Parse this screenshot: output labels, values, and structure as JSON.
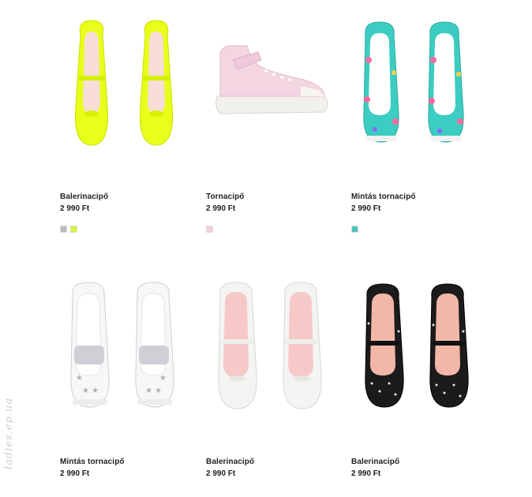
{
  "products": [
    {
      "title": "Balerinacipő",
      "price": "2 990 Ft",
      "image_icon": "neon-ballet-flats-icon",
      "swatches": [
        "#b9bcc0",
        "#d8f53a"
      ]
    },
    {
      "title": "Tornacipő",
      "price": "2 990 Ft",
      "image_icon": "pink-high-top-sneaker-icon",
      "swatches": [
        "#f1cfdc"
      ]
    },
    {
      "title": "Mintás tornacipő",
      "price": "2 990 Ft",
      "image_icon": "floral-slip-on-icon",
      "swatches": [
        "#4cc3b8"
      ]
    },
    {
      "title": "Mintás tornacipő",
      "price": "2 990 Ft",
      "image_icon": "star-print-slip-on-icon",
      "swatches": []
    },
    {
      "title": "Balerinacipő",
      "price": "2 990 Ft",
      "image_icon": "white-ballet-flats-icon",
      "swatches": []
    },
    {
      "title": "Balerinacipő",
      "price": "2 990 Ft",
      "image_icon": "black-polka-ballet-flats-icon",
      "swatches": []
    }
  ],
  "watermark": "ladies.ep.ua",
  "colors": {
    "neon": "#e8ff1a",
    "pink": "#f4d6e3",
    "teal": "#3ccdc2",
    "white_shoe": "#f4f4f2",
    "black_shoe": "#1b1b1b"
  }
}
